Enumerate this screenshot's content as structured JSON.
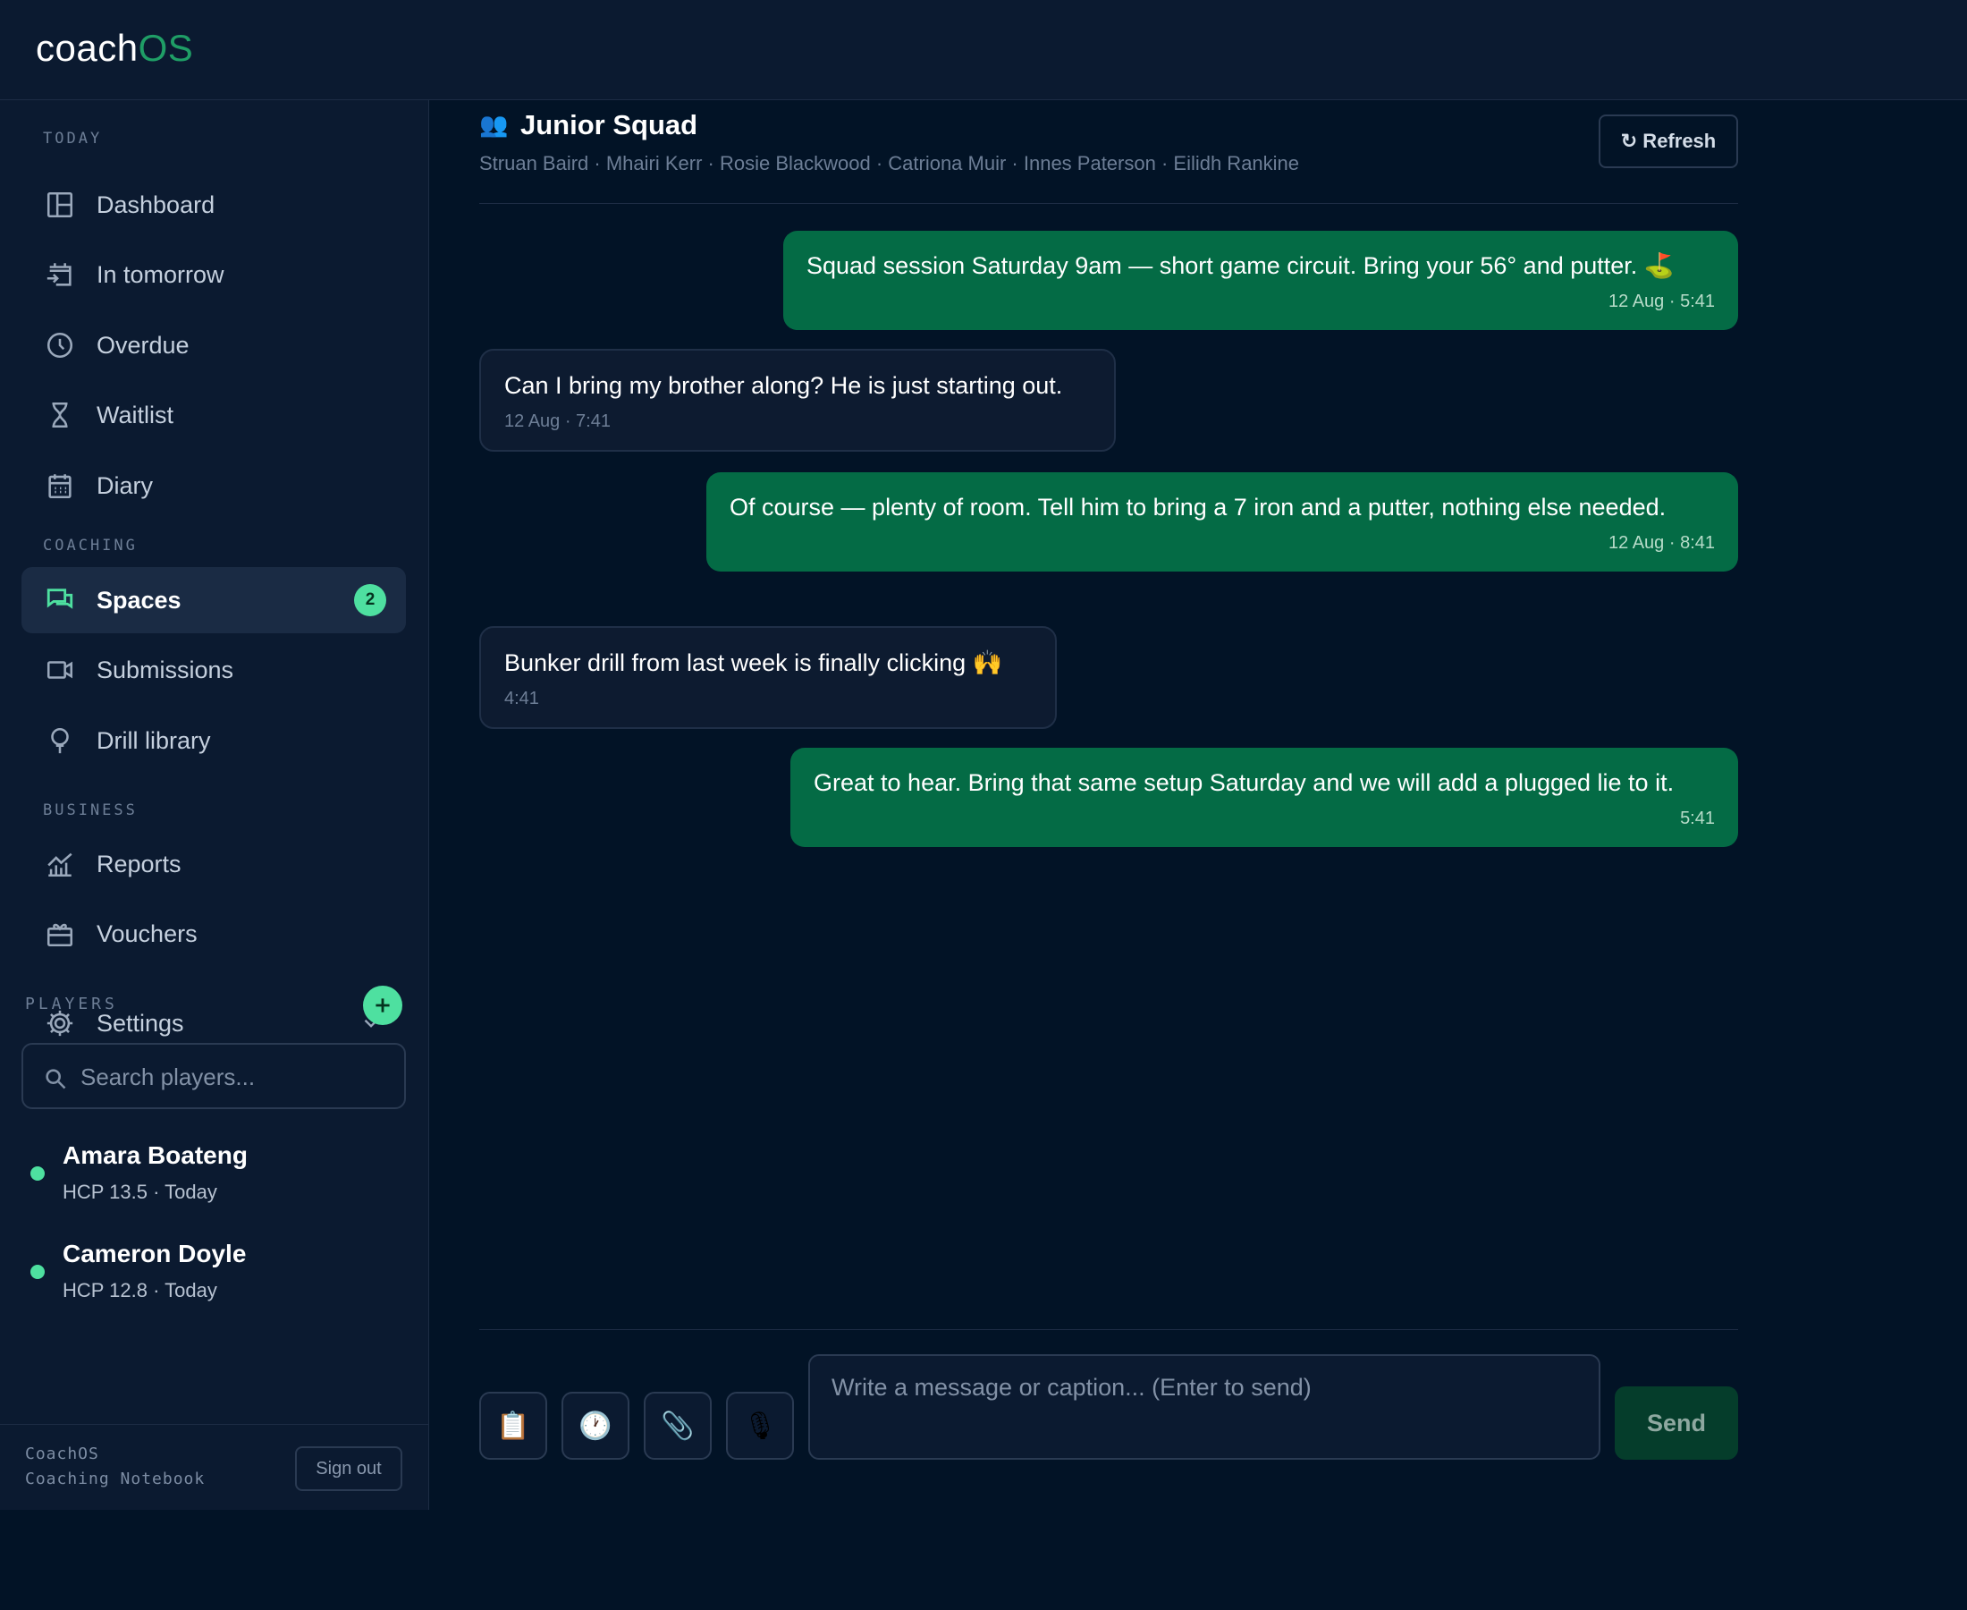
{
  "app": {
    "logo_main": "coach",
    "logo_accent": "OS"
  },
  "sidebar": {
    "sections": {
      "today": "TODAY",
      "coaching": "COACHING",
      "business": "BUSINESS"
    },
    "items": [
      {
        "label": "Dashboard",
        "icon": "dashboard-icon"
      },
      {
        "label": "In tomorrow",
        "icon": "calendar-arrow-icon"
      },
      {
        "label": "Overdue",
        "icon": "clock-icon"
      },
      {
        "label": "Waitlist",
        "icon": "hourglass-icon"
      },
      {
        "label": "Diary",
        "icon": "calendar-icon"
      },
      {
        "label": "Spaces",
        "icon": "chat-icon",
        "badge": "2",
        "active": true
      },
      {
        "label": "Submissions",
        "icon": "video-icon"
      },
      {
        "label": "Drill library",
        "icon": "golf-ball-tee-icon"
      },
      {
        "label": "Reports",
        "icon": "chart-icon"
      },
      {
        "label": "Vouchers",
        "icon": "gift-icon"
      },
      {
        "label": "Settings",
        "icon": "gear-icon"
      }
    ],
    "players_label": "PLAYERS",
    "search_placeholder": "Search players...",
    "players": [
      {
        "name": "Amara Boateng",
        "meta": "HCP 13.5 · Today"
      },
      {
        "name": "Cameron Doyle",
        "meta": "HCP 12.8 · Today"
      }
    ],
    "footer": {
      "line1": "CoachOS",
      "line2": "Coaching Notebook",
      "signout": "Sign out"
    }
  },
  "space": {
    "icon": "👥",
    "title": "Junior Squad",
    "members": "Struan Baird · Mhairi Kerr · Rosie Blackwood · Catriona Muir · Innes Paterson · Eilidh Rankine",
    "refresh_label": "↻ Refresh"
  },
  "messages": [
    {
      "direction": "out",
      "text": "Squad session Saturday 9am — short game circuit. Bring your 56° and putter. ⛳",
      "time": "12 Aug · 5:41"
    },
    {
      "direction": "in",
      "text": "Can I bring my brother along? He is just starting out.",
      "time": "12 Aug · 7:41"
    },
    {
      "direction": "out",
      "text": "Of course — plenty of room. Tell him to bring a 7 iron and a putter, nothing else needed.",
      "time": "12 Aug · 8:41"
    },
    {
      "direction": "in",
      "text": "Bunker drill from last week is finally clicking 🙌",
      "time": "4:41"
    },
    {
      "direction": "out",
      "text": "Great to hear. Bring that same setup Saturday and we will add a plugged lie to it.",
      "time": "5:41"
    }
  ],
  "composer": {
    "tools": [
      "📋",
      "🕐",
      "📎",
      "🎙"
    ],
    "placeholder": "Write a message or caption... (Enter to send)",
    "send_label": "Send"
  },
  "colors": {
    "accent": "#1f9e66",
    "outgoing_bubble": "#046b45",
    "badge": "#4ee0a0",
    "background": "#021326",
    "sidebar": "#0b1a30"
  }
}
